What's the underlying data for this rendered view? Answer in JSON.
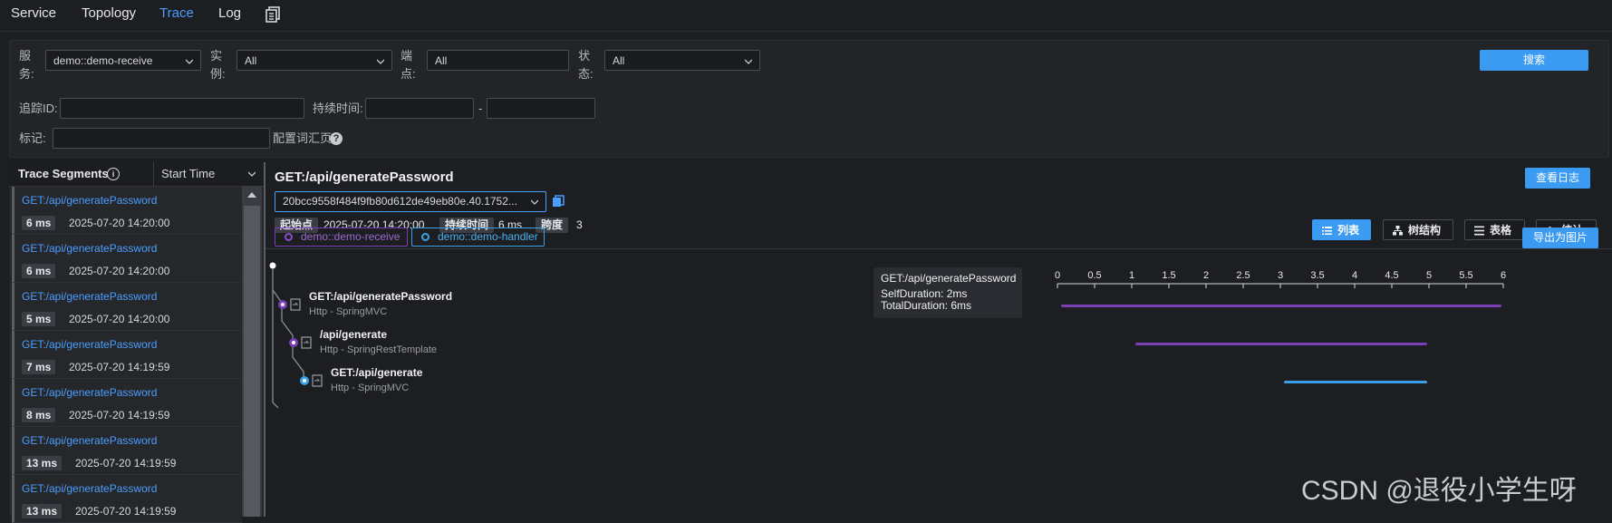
{
  "nav": {
    "items": [
      {
        "label": "Service",
        "active": false
      },
      {
        "label": "Topology",
        "active": false
      },
      {
        "label": "Trace",
        "active": true
      },
      {
        "label": "Log",
        "active": false
      }
    ],
    "doc_icon": "document-copy-icon"
  },
  "filters": {
    "service_label_1": "服",
    "service_label_2": "务:",
    "service_value": "demo::demo-receive",
    "instance_label_1": "实",
    "instance_label_2": "例:",
    "instance_value": "All",
    "endpoint_label_1": "端",
    "endpoint_label_2": "点:",
    "endpoint_value": "All",
    "status_label_1": "状",
    "status_label_2": "态:",
    "status_value": "All",
    "search_button": "搜索",
    "trace_id_label": "追踪ID:",
    "trace_id_value": "",
    "duration_label": "持续时间:",
    "duration_separator": "-",
    "tags_label": "标记:",
    "config_label": "配置词汇页",
    "help_glyph": "?"
  },
  "segments": {
    "header_title": "Trace Segments",
    "info_glyph": "i",
    "sort_value": "Start Time",
    "items": [
      {
        "endpoint": "GET:/api/generatePassword",
        "duration": "6 ms",
        "time": "2025-07-20 14:20:00"
      },
      {
        "endpoint": "GET:/api/generatePassword",
        "duration": "6 ms",
        "time": "2025-07-20 14:20:00"
      },
      {
        "endpoint": "GET:/api/generatePassword",
        "duration": "5 ms",
        "time": "2025-07-20 14:20:00"
      },
      {
        "endpoint": "GET:/api/generatePassword",
        "duration": "7 ms",
        "time": "2025-07-20 14:19:59"
      },
      {
        "endpoint": "GET:/api/generatePassword",
        "duration": "8 ms",
        "time": "2025-07-20 14:19:59"
      },
      {
        "endpoint": "GET:/api/generatePassword",
        "duration": "13 ms",
        "time": "2025-07-20 14:19:59"
      },
      {
        "endpoint": "GET:/api/generatePassword",
        "duration": "13 ms",
        "time": "2025-07-20 14:19:59"
      }
    ]
  },
  "detail": {
    "title": "GET:/api/generatePassword",
    "view_logs_button": "查看日志",
    "trace_id": "20bcc9558f484f9fb80d612de49eb80e.40.1752...",
    "start_label": "起始点",
    "start_value": "2025-07-20 14:20:00",
    "duration_label": "持续时间",
    "duration_value": "6 ms",
    "span_label": "跨度",
    "span_value": "3",
    "views": [
      {
        "label": "列表",
        "icon": "list-icon",
        "active": true
      },
      {
        "label": "树结构",
        "icon": "tree-structure-icon",
        "active": false
      },
      {
        "label": "表格",
        "icon": "table-icon",
        "active": false
      },
      {
        "label": "统计",
        "icon": "bar-chart-icon",
        "active": false
      }
    ],
    "export_button": "导出为图片",
    "services": [
      {
        "name": "demo::demo-receive",
        "color": "#8a4fc9"
      },
      {
        "name": "demo::demo-handler",
        "color": "#3aa0e8"
      }
    ],
    "tooltip": {
      "endpoint": "GET:/api/generatePassword",
      "self_duration": "SelfDuration: 2ms",
      "total_duration": "TotalDuration: 6ms"
    },
    "axis_ticks": [
      "0",
      "0.5",
      "1",
      "1.5",
      "2",
      "2.5",
      "3",
      "3.5",
      "4",
      "4.5",
      "5",
      "5.5",
      "6"
    ],
    "spans": [
      {
        "endpoint": "GET:/api/generatePassword",
        "component": "Http - SpringMVC",
        "start": 0,
        "end": 6,
        "color": "#7a3fb5"
      },
      {
        "endpoint": "/api/generate",
        "component": "Http - SpringRestTemplate",
        "start": 1,
        "end": 5,
        "color": "#7a3fb5"
      },
      {
        "endpoint": "GET:/api/generate",
        "component": "Http - SpringMVC",
        "start": 3,
        "end": 5,
        "color": "#3aa0e8"
      }
    ]
  },
  "watermark": "CSDN @退役小学生呀"
}
